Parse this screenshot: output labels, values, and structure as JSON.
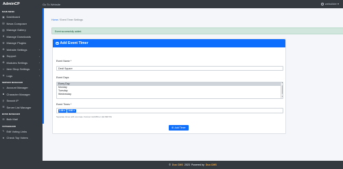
{
  "topbar": {
    "brand": "AdminCP",
    "goto": "Go To Website",
    "user": "webuilder ▾"
  },
  "sidebar": {
    "sections": {
      "main": "MAIN MENU",
      "server": "SERVER MANAGER",
      "boss": "BOSS MANAGER",
      "voteboard": "VOTEBOARD"
    },
    "items": [
      {
        "label": "Dashboard",
        "icon": "dashboard-icon",
        "glyph": "▣",
        "arrow": false
      },
      {
        "label": "News Composer",
        "icon": "news-icon",
        "glyph": "▤",
        "arrow": false
      },
      {
        "label": "Manage Gallery",
        "icon": "gallery-icon",
        "glyph": "▧",
        "arrow": false
      },
      {
        "label": "Manage Downloads",
        "icon": "download-icon",
        "glyph": "⬇",
        "arrow": false
      },
      {
        "label": "Manage Plugins",
        "icon": "plugin-icon",
        "glyph": "⚒",
        "arrow": false
      },
      {
        "label": "Website Settings",
        "icon": "settings-icon",
        "glyph": "⚙",
        "arrow": true
      },
      {
        "label": "Support",
        "icon": "support-icon",
        "glyph": "◉",
        "arrow": true
      },
      {
        "label": "Modules Settings",
        "icon": "modules-icon",
        "glyph": "⚙",
        "arrow": true
      },
      {
        "label": "Item Shop Settings",
        "icon": "shop-icon",
        "glyph": "☆",
        "arrow": true
      },
      {
        "label": "Logs",
        "icon": "logs-icon",
        "glyph": "≣",
        "arrow": true
      },
      {
        "label": "Account Manager",
        "icon": "account-icon",
        "glyph": "☺",
        "arrow": false
      },
      {
        "label": "Character Manager",
        "icon": "character-icon",
        "glyph": "☻",
        "arrow": false
      },
      {
        "label": "Search IP",
        "icon": "search-icon",
        "glyph": "⚲",
        "arrow": false
      },
      {
        "label": "Server List Manager",
        "icon": "server-icon",
        "glyph": "☰",
        "arrow": false
      },
      {
        "label": "Bulk Mail",
        "icon": "mail-icon",
        "glyph": "✉",
        "arrow": false
      },
      {
        "label": "Edit Voting Links",
        "icon": "link-icon",
        "glyph": "✎",
        "arrow": false
      },
      {
        "label": "Check Top Voters",
        "icon": "trophy-icon",
        "glyph": "★",
        "arrow": false
      }
    ]
  },
  "breadcrumb": {
    "home": "Home",
    "sep": "/",
    "current": "Event Timer Settings"
  },
  "alert": "Event successfully added.",
  "form": {
    "title": "Add Event Timer",
    "event_name_label": "Event Name *",
    "event_name_value": "Devil Square",
    "event_days_label": "Event Days",
    "days": [
      "Every Day",
      "Monday",
      "Tuesday",
      "Wednesday"
    ],
    "selected_day": "Every Day",
    "event_times_label": "Event Times *",
    "times": [
      "1:00",
      "3:00"
    ],
    "help": "Separate times with commas. Format: HH:MM or HH:MM:SS",
    "submit": "Add Timer"
  },
  "footer": {
    "left": "©",
    "brand1": "Duo CMS",
    "year": "2023",
    "powered": "Powered by",
    "brand2": "Duo CMS"
  },
  "colors": {
    "primary": "#0d6efd",
    "sidebar": "#343a40",
    "success_bg": "#d1e7dd",
    "background": "#f4f6f9"
  }
}
